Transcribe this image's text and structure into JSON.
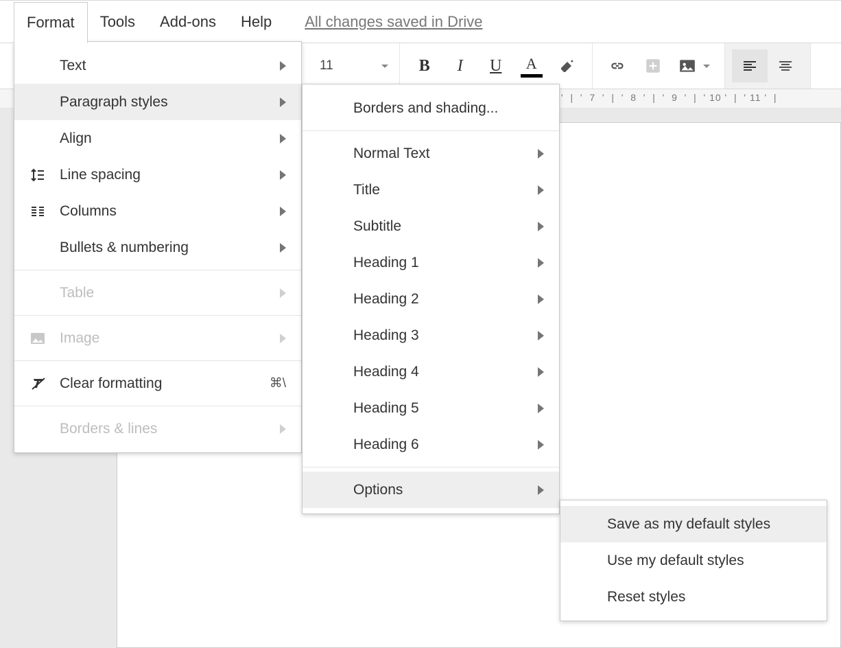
{
  "menubar": {
    "items": [
      {
        "label": "Format",
        "active": true
      },
      {
        "label": "Tools",
        "active": false
      },
      {
        "label": "Add-ons",
        "active": false
      },
      {
        "label": "Help",
        "active": false
      }
    ],
    "save_status": "All changes saved in Drive"
  },
  "toolbar": {
    "font_size": "11"
  },
  "ruler": {
    "labels": [
      "7",
      "8",
      "9",
      "10",
      "11"
    ]
  },
  "format_menu": {
    "items": [
      {
        "label": "Text",
        "submenu": true
      },
      {
        "label": "Paragraph styles",
        "submenu": true,
        "hovered": true
      },
      {
        "label": "Align",
        "submenu": true
      },
      {
        "label": "Line spacing",
        "submenu": true,
        "icon": "line-spacing"
      },
      {
        "label": "Columns",
        "submenu": true,
        "icon": "columns"
      },
      {
        "label": "Bullets & numbering",
        "submenu": true
      },
      {
        "sep": true
      },
      {
        "label": "Table",
        "submenu": true,
        "disabled": true
      },
      {
        "sep": true
      },
      {
        "label": "Image",
        "submenu": true,
        "disabled": true,
        "icon": "image"
      },
      {
        "sep": true
      },
      {
        "label": "Clear formatting",
        "icon": "clear-format",
        "accel": "⌘\\"
      },
      {
        "sep": true
      },
      {
        "label": "Borders & lines",
        "submenu": true,
        "disabled": true
      }
    ]
  },
  "paragraph_menu": {
    "items": [
      {
        "label": "Borders and shading..."
      },
      {
        "sep": true
      },
      {
        "label": "Normal Text",
        "submenu": true
      },
      {
        "label": "Title",
        "submenu": true
      },
      {
        "label": "Subtitle",
        "submenu": true
      },
      {
        "label": "Heading 1",
        "submenu": true
      },
      {
        "label": "Heading 2",
        "submenu": true
      },
      {
        "label": "Heading 3",
        "submenu": true
      },
      {
        "label": "Heading 4",
        "submenu": true
      },
      {
        "label": "Heading 5",
        "submenu": true
      },
      {
        "label": "Heading 6",
        "submenu": true
      },
      {
        "sep": true
      },
      {
        "label": "Options",
        "submenu": true,
        "hovered": true
      }
    ]
  },
  "options_menu": {
    "items": [
      {
        "label": "Save as my default styles",
        "hovered": true
      },
      {
        "label": "Use my default styles"
      },
      {
        "label": "Reset styles"
      }
    ]
  }
}
